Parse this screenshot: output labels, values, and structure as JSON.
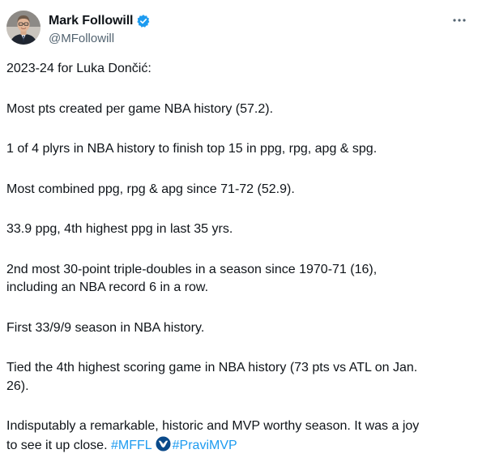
{
  "author": {
    "display_name": "Mark Followill",
    "handle": "@MFollowill"
  },
  "icons": {
    "verified": "verified-badge-icon",
    "more": "more-options-icon",
    "team": "dallas-mavericks-logo-icon"
  },
  "colors": {
    "text": "#0f1419",
    "secondary": "#536471",
    "link": "#1d9bf0",
    "verified": "#1d9bf0"
  },
  "tweet": {
    "p1": "2023-24 for Luka Dončić:",
    "p2": "Most pts created per game NBA history (57.2).",
    "p3": "1 of 4 plyrs in NBA history to finish top 15 in ppg, rpg, apg & spg.",
    "p4": "Most combined ppg, rpg & apg since 71-72 (52.9).",
    "p5": "33.9 ppg, 4th highest ppg in last 35 yrs.",
    "p6a": "2nd most 30-point triple-doubles in a season since 1970-71 (16),",
    "p6b": "including an NBA record 6 in a row.",
    "p7": "First 33/9/9 season in NBA history.",
    "p8a": "Tied the 4th highest scoring game in NBA history (73 pts vs ATL on Jan.",
    "p8b": "26).",
    "p9a": "Indisputably a remarkable, historic and MVP worthy season. It was a joy",
    "p9b": "to see it up close.",
    "hashtag1": "#MFFL",
    "hashtag2": "#PraviMVP"
  }
}
